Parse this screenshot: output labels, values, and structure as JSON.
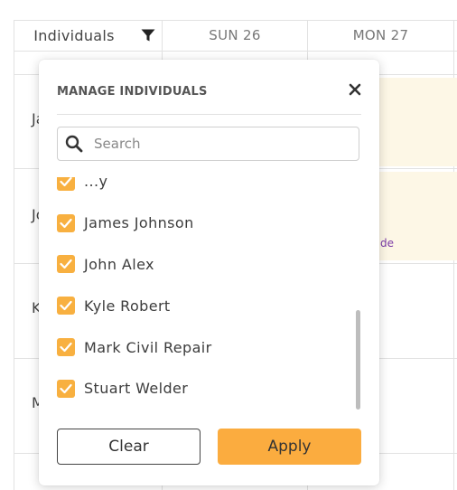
{
  "header": {
    "individuals_label": "Individuals",
    "columns": [
      "SUN 26",
      "MON 27"
    ]
  },
  "rows": [
    {
      "label": "Ja"
    },
    {
      "label": "Jo"
    },
    {
      "label": "K"
    },
    {
      "label": "M"
    }
  ],
  "event_snippet": "de",
  "modal": {
    "title": "MANAGE INDIVIDUALS",
    "close_glyph": "✕",
    "search": {
      "placeholder": "Search",
      "value": ""
    },
    "items": [
      {
        "label": "...y",
        "checked": true
      },
      {
        "label": "James Johnson",
        "checked": true
      },
      {
        "label": "John Alex",
        "checked": true
      },
      {
        "label": "Kyle Robert",
        "checked": true
      },
      {
        "label": "Mark Civil Repair",
        "checked": true
      },
      {
        "label": "Stuart Welder",
        "checked": true
      }
    ],
    "clear_label": "Clear",
    "apply_label": "Apply"
  },
  "colors": {
    "accent": "#fbac3f",
    "checkbox": "#f8b040",
    "event_bg": "#fdf7e6",
    "event_text": "#7a3aa6"
  },
  "icons": {
    "filter": "filter-icon",
    "close": "close-icon",
    "search": "search-icon",
    "check": "check-icon"
  }
}
